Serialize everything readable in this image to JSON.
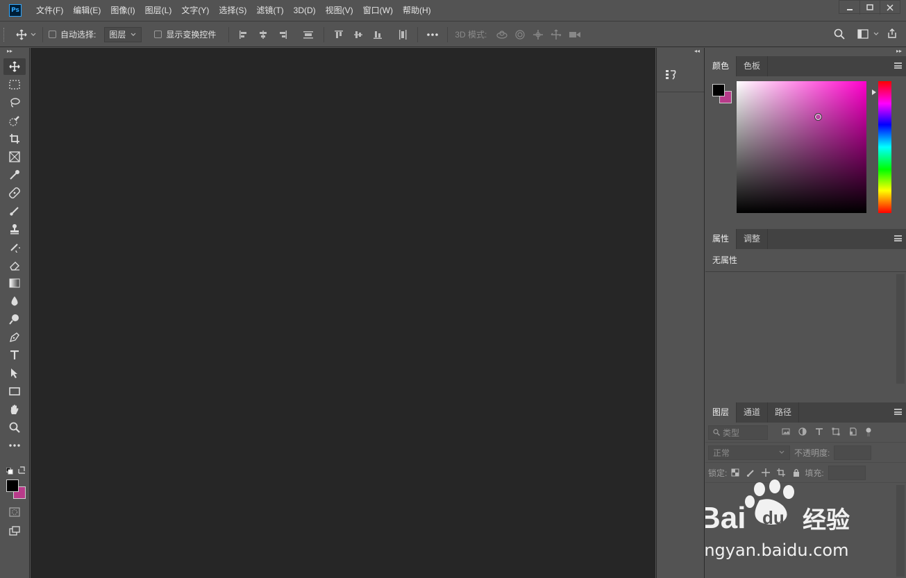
{
  "app": {
    "logo_text": "Ps"
  },
  "menu": [
    "文件(F)",
    "编辑(E)",
    "图像(I)",
    "图层(L)",
    "文字(Y)",
    "选择(S)",
    "滤镜(T)",
    "3D(D)",
    "视图(V)",
    "窗口(W)",
    "帮助(H)"
  ],
  "options": {
    "auto_select_label": "自动选择:",
    "auto_select_value": "图层",
    "show_transform_label": "显示变换控件",
    "mode_3d_label": "3D 模式:"
  },
  "panels": {
    "color_tabs": [
      "颜色",
      "色板"
    ],
    "props_tabs": [
      "属性",
      "调整"
    ],
    "props_empty": "无属性",
    "layers_tabs": [
      "图层",
      "通道",
      "路径"
    ],
    "layers_filter_placeholder": "类型",
    "blend_mode": "正常",
    "opacity_label": "不透明度:",
    "lock_label": "锁定:",
    "fill_label": "填充:"
  },
  "colors": {
    "foreground": "#000000",
    "background": "#b83b8a",
    "accent": "#31a8ff"
  },
  "watermark": {
    "brand": "Bai",
    "brand_du": "du",
    "product": "经验",
    "url": "jingyan.baidu.com"
  }
}
